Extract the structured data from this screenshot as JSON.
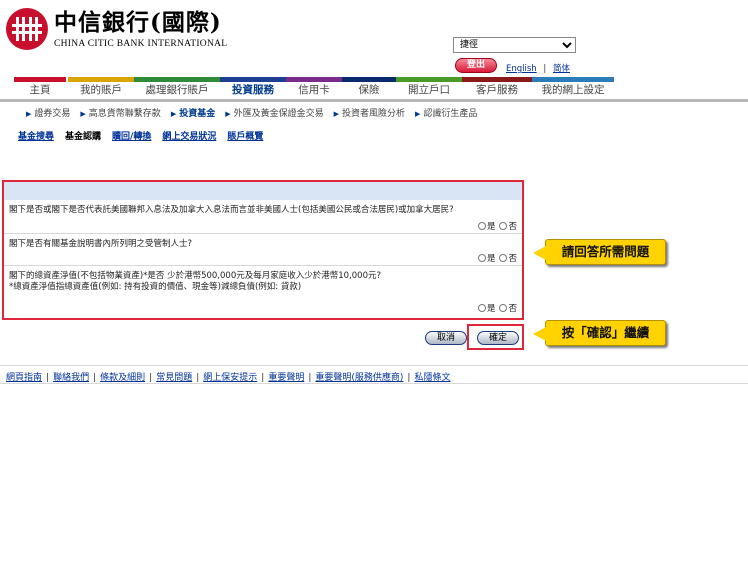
{
  "header": {
    "bank_name_cn": "中信銀行(國際)",
    "bank_name_en": "CHINA CITIC BANK INTERNATIONAL",
    "language_select": "捷徑",
    "logout_label": "登出",
    "english_link": "English",
    "simplified_link": "简体",
    "link_separator": "|"
  },
  "nav": [
    {
      "label": "主頁",
      "color": "#c8102e"
    },
    {
      "label": "我的賬戶",
      "color": "#d9a300"
    },
    {
      "label": "處理銀行賬戶",
      "color": "#2e8b3a"
    },
    {
      "label": "投資服務",
      "color": "#1c3f94",
      "active": true
    },
    {
      "label": "信用卡",
      "color": "#7b2c8a"
    },
    {
      "label": "保險",
      "color": "#0a2a6e"
    },
    {
      "label": "開立戶口",
      "color": "#4a9a28"
    },
    {
      "label": "客戶服務",
      "color": "#8a1a1a"
    },
    {
      "label": "我的網上設定",
      "color": "#2a7db8"
    }
  ],
  "sub_nav": [
    {
      "label": "證券交易"
    },
    {
      "label": "高息貨幣聯繫存款"
    },
    {
      "label": "投資基金",
      "active": true
    },
    {
      "label": "外匯及黃金保證金交易"
    },
    {
      "label": "投資者風險分析"
    },
    {
      "label": "認識衍生產品"
    }
  ],
  "third_nav": [
    {
      "label": "基金搜尋"
    },
    {
      "label": "基金認購",
      "active": true
    },
    {
      "label": "贖回/轉換"
    },
    {
      "label": "網上交易狀況"
    },
    {
      "label": "賬戶概覽"
    }
  ],
  "questions": [
    {
      "lines": [
        "閣下是否或閣下是否代表託美國聯邦入息法及加拿大入息法而言並非美國人士(包括美國公民或合法居民)或加拿大居民?"
      ],
      "yes": "是",
      "no": "否"
    },
    {
      "lines": [
        "閣下是否有關基金說明書內所列明之受管制人士?"
      ],
      "yes": "是",
      "no": "否"
    },
    {
      "lines": [
        "閣下的總資產淨值(不包括物業資產)*是否 少於港幣500,000元及每月家庭收入少於港幣10,000元?",
        "*總資產淨值指總資產值(例如: 持有投資的價值、現金等)減總負債(例如: 貸款)"
      ],
      "yes": "是",
      "no": "否"
    }
  ],
  "buttons": {
    "cancel_label": "取消",
    "confirm_label": "確定"
  },
  "callouts": {
    "answer_prompt": "請回答所需問題",
    "confirm_prompt": "按「確認」繼續"
  },
  "footer": {
    "links": [
      "網頁指南",
      "聯絡我們",
      "條款及細則",
      "常見問題",
      "網上保安提示",
      "重要聲明",
      "重要聲明(服務供應商)",
      "私隱條文"
    ],
    "separator": "|"
  }
}
